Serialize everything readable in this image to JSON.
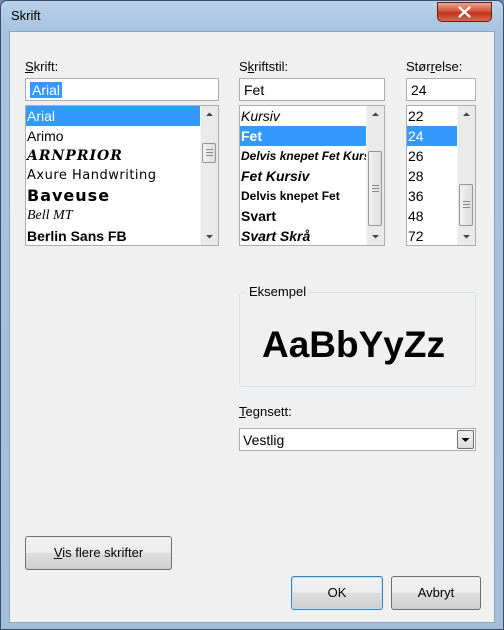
{
  "window": {
    "title": "Skrift"
  },
  "font": {
    "label_pre": "",
    "label_ul": "S",
    "label_post": "krift:",
    "value": "Arial",
    "items": [
      "Arial",
      "Arimo",
      "ARNPRIOR",
      "Axure Handwriting",
      "Baveuse",
      "Bell MT",
      "Berlin Sans FB"
    ],
    "selected_index": 0
  },
  "style": {
    "label_pre": "S",
    "label_ul": "k",
    "label_post": "riftstil:",
    "value": "Fet",
    "items": [
      "Kursiv",
      "Fet",
      "Delvis knepet Fet Kursiv",
      "Fet Kursiv",
      "Delvis knepet Fet",
      "Svart",
      "Svart Skrå"
    ],
    "selected_index": 1
  },
  "size": {
    "label_pre": "Stør",
    "label_ul": "r",
    "label_post": "else:",
    "value": "24",
    "items": [
      "22",
      "24",
      "26",
      "28",
      "36",
      "48",
      "72"
    ],
    "selected_index": 1
  },
  "sample": {
    "group_label": "Eksempel",
    "text": "AaBbYyZz"
  },
  "charset": {
    "label_pre": "",
    "label_ul": "T",
    "label_post": "egnsett:",
    "value": "Vestlig"
  },
  "buttons": {
    "more_pre": "",
    "more_ul": "V",
    "more_post": "is flere skrifter",
    "ok": "OK",
    "cancel": "Avbryt"
  },
  "colors": {
    "selection": "#3399ff",
    "dialog_bg": "#f0f0f0",
    "close_button": "#c7432b"
  }
}
